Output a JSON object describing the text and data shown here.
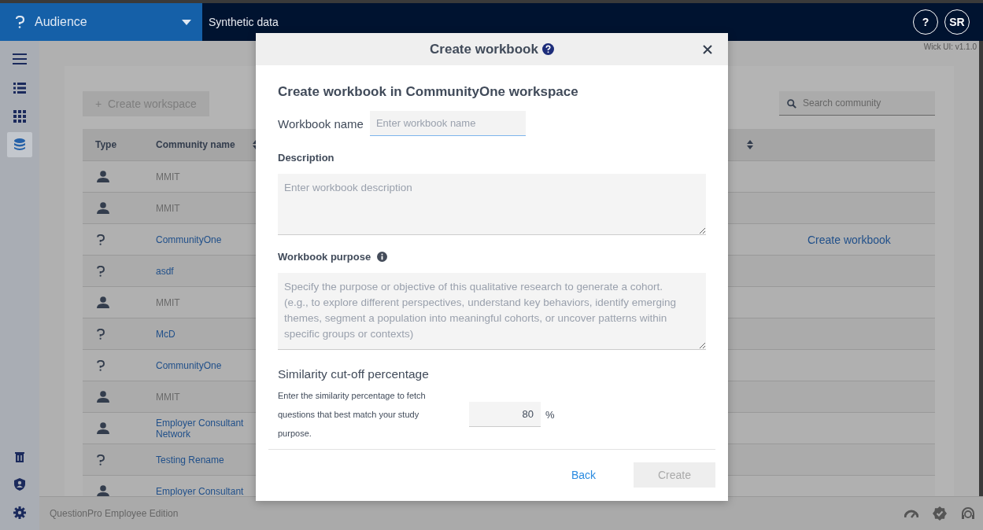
{
  "topbar": {
    "app_name": "Audience",
    "section": "Synthetic data",
    "help": "?",
    "avatar": "SR"
  },
  "sidebar": {
    "items": [
      {
        "kind": "list",
        "selected": false
      },
      {
        "kind": "grid",
        "selected": false
      },
      {
        "kind": "database",
        "selected": true
      }
    ],
    "bottom_items": [
      {
        "kind": "trash"
      },
      {
        "kind": "shield"
      },
      {
        "kind": "gear"
      }
    ]
  },
  "version": "Wick UI: v1.1.0",
  "toolbar": {
    "create_button": "+  Create workspace",
    "search": {
      "placeholder": "Search community"
    }
  },
  "table": {
    "columns": [
      "Type",
      "Community name"
    ],
    "rows": [
      {
        "kind": "person",
        "name": "MMIT",
        "link": false
      },
      {
        "kind": "person",
        "name": "MMIT",
        "link": false
      },
      {
        "kind": "questionpro",
        "name": "CommunityOne",
        "link": true,
        "action": "Create workbook"
      },
      {
        "kind": "questionpro",
        "name": "asdf",
        "link": true
      },
      {
        "kind": "person",
        "name": "MMIT",
        "link": false
      },
      {
        "kind": "questionpro",
        "name": "McD",
        "link": true
      },
      {
        "kind": "questionpro",
        "name": "CommunityOne",
        "link": true
      },
      {
        "kind": "person",
        "name": "MMIT",
        "link": false
      },
      {
        "kind": "person",
        "name": "Employer Consultant Network",
        "link": true
      },
      {
        "kind": "questionpro",
        "name": "Testing Rename",
        "link": true
      },
      {
        "kind": "person",
        "name": "Employer Consultant",
        "link": true
      }
    ]
  },
  "footer": {
    "text": "QuestionPro Employee Edition"
  },
  "dialog": {
    "title": "Create workbook",
    "heading": "Create workbook in CommunityOne workspace",
    "workbook_name": {
      "label": "Workbook name",
      "placeholder": "Enter workbook name"
    },
    "description": {
      "label": "Description",
      "placeholder": "Enter workbook description"
    },
    "purpose": {
      "label": "Workbook purpose",
      "placeholder": "Specify the purpose or objective of this qualitative research to generate a cohort.\n(e.g., to explore different perspectives, understand key behaviors, identify emerging themes, segment a population into meaningful cohorts, or uncover patterns within specific groups or contexts)"
    },
    "similarity": {
      "title": "Similarity cut-off percentage",
      "help": "Enter the similarity percentage to fetch questions that best match your study purpose.",
      "value": "80",
      "unit": "%"
    },
    "back": "Back",
    "create": {
      "label": "Create",
      "disabled": true
    }
  }
}
